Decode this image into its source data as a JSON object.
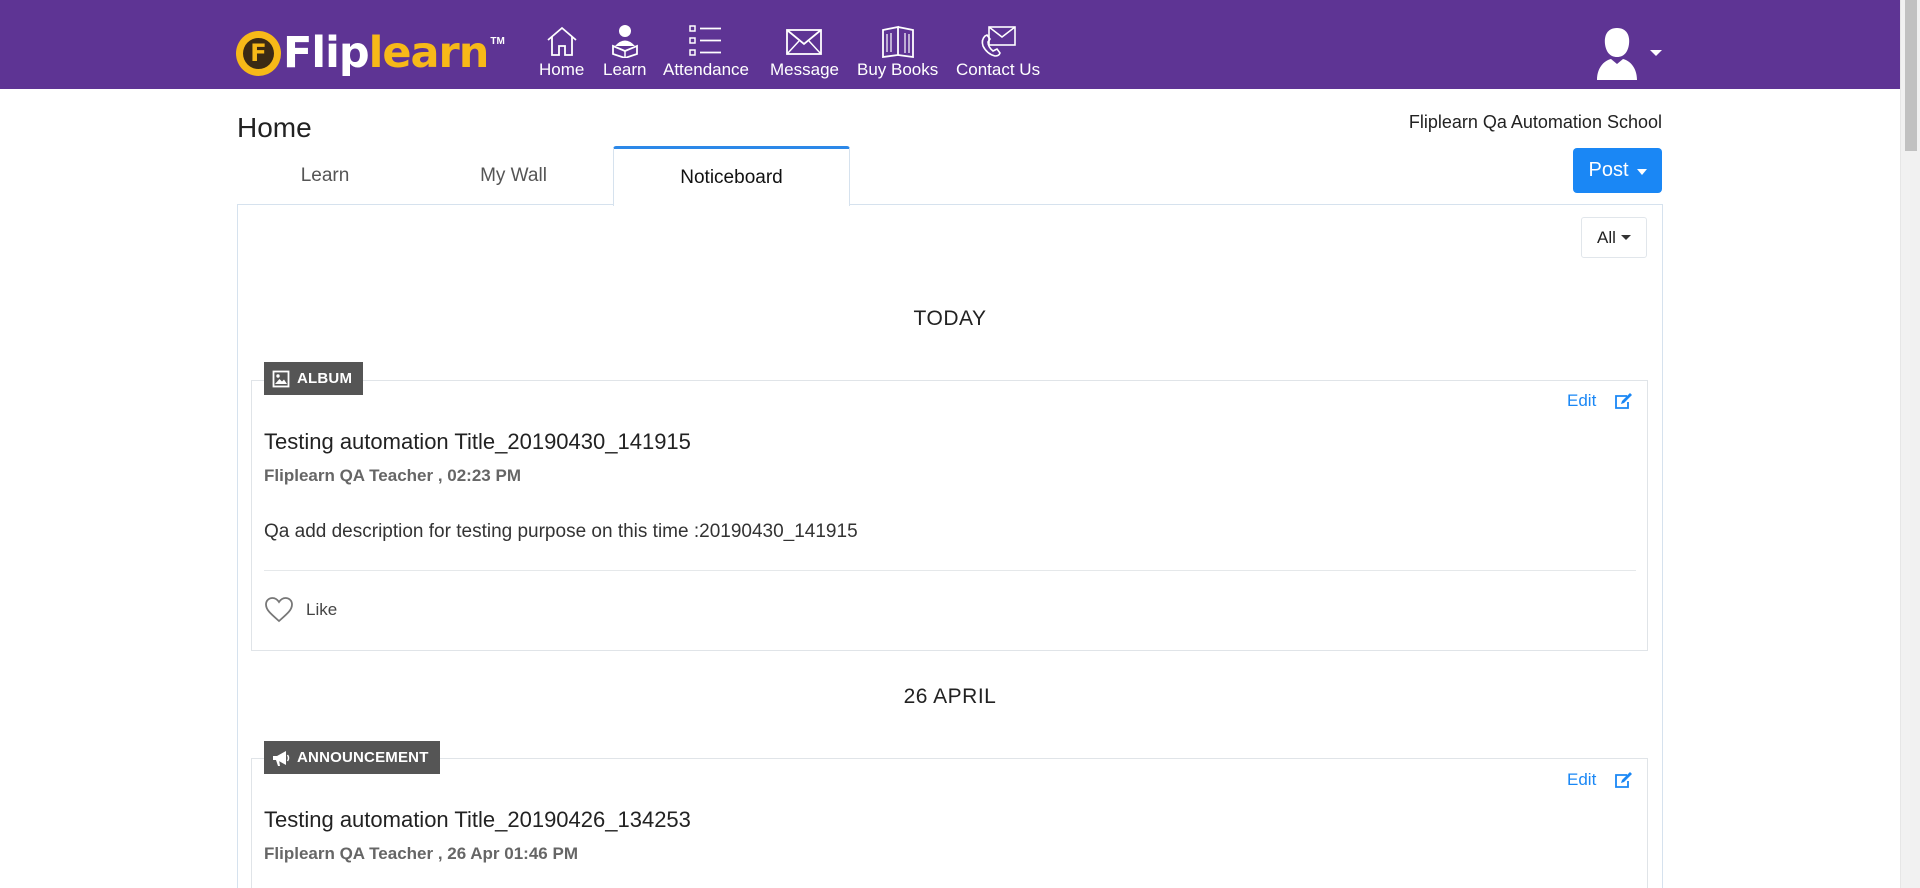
{
  "brand": {
    "flip": "Flip",
    "learn": "learn",
    "tm": "TM",
    "badge_letter": "F"
  },
  "nav": [
    {
      "label": "Home",
      "icon": "home-icon"
    },
    {
      "label": "Learn",
      "icon": "learn-icon"
    },
    {
      "label": "Attendance",
      "icon": "attendance-icon"
    },
    {
      "label": "Message",
      "icon": "message-icon"
    },
    {
      "label": "Buy Books",
      "icon": "books-icon"
    },
    {
      "label": "Contact Us",
      "icon": "contact-icon"
    }
  ],
  "header": {
    "title": "Home",
    "school": "Fliplearn Qa Automation School"
  },
  "tabs": {
    "learn": "Learn",
    "wall": "My Wall",
    "notice": "Noticeboard",
    "active": "Noticeboard"
  },
  "post_button": "Post",
  "filter": {
    "selected": "All"
  },
  "colors": {
    "topbar": "#5e3494",
    "accent": "#1a87f5",
    "brand_yellow": "#f7b918",
    "badge": "#555555"
  },
  "feed": {
    "sections": [
      {
        "heading": "TODAY",
        "post": {
          "badge": "ALBUM",
          "badge_icon": "image-icon",
          "edit": "Edit",
          "title": "Testing automation Title_20190430_141915",
          "meta": "Fliplearn QA Teacher , 02:23 PM",
          "description": "Qa add description for testing purpose on this time :20190430_141915",
          "like": "Like"
        }
      },
      {
        "heading": "26 APRIL",
        "post": {
          "badge": "ANNOUNCEMENT",
          "badge_icon": "megaphone-icon",
          "edit": "Edit",
          "title": "Testing automation Title_20190426_134253",
          "meta": "Fliplearn QA Teacher , 26 Apr 01:46 PM"
        }
      }
    ]
  }
}
